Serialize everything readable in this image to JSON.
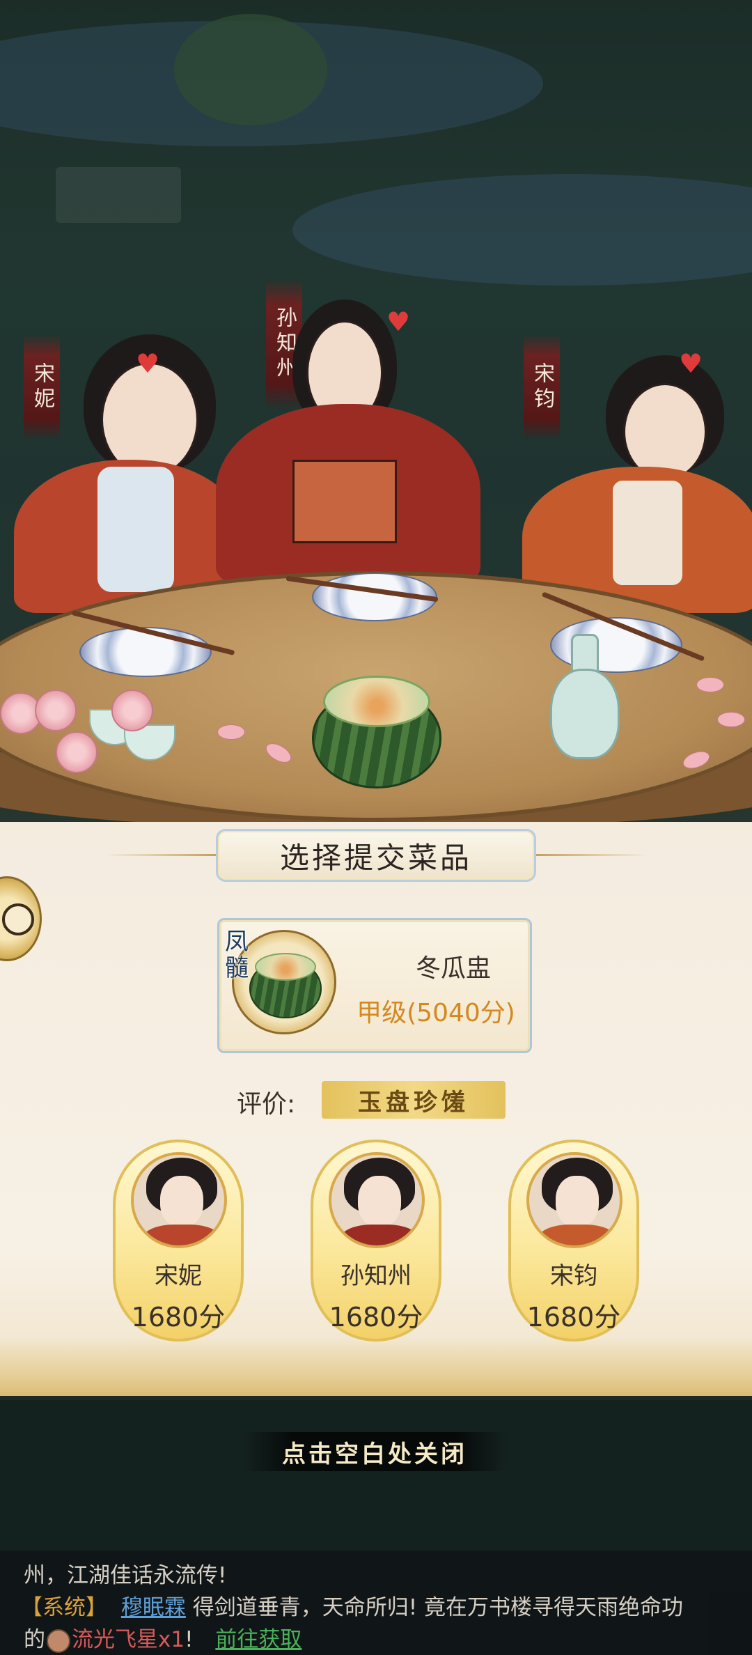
{
  "scene": {
    "characters": [
      {
        "id": "song-ni",
        "name": "宋妮"
      },
      {
        "id": "sun-zhizhou",
        "name": "孙知州"
      },
      {
        "id": "song-jun",
        "name": "宋钧"
      }
    ]
  },
  "panel": {
    "title": "选择提交菜品",
    "dish": {
      "tag": "凤髓",
      "name": "冬瓜盅",
      "grade": "甲级(5040分)"
    },
    "evaluation": {
      "label": "评价:",
      "value": "玉盘珍馐"
    },
    "judges": [
      {
        "name": "宋妮",
        "score": "1680分"
      },
      {
        "name": "孙知州",
        "score": "1680分"
      },
      {
        "name": "宋钧",
        "score": "1680分"
      }
    ]
  },
  "close_hint": "点击空白处关闭",
  "chat": {
    "line1": "州，江湖佳话永流传!",
    "line2": {
      "system_tag": "【系统】",
      "player": "穆眠霖",
      "text": "得剑道垂青，天命所归! 竟在万书楼寻得天雨绝命功"
    },
    "line3": {
      "prefix": "的",
      "item": "流光飞星x1",
      "suffix": "!",
      "link": "前往获取"
    }
  },
  "colors": {
    "grade": "#d3891f",
    "system_tag": "#d9a23c",
    "player_link": "#5f9ed6",
    "item": "#d85a5a",
    "goto_link": "#49b25a",
    "eval_badge": "#e3c15c"
  },
  "icons": {
    "side_button": "chat-bubble-icon",
    "chat_item": "item-icon"
  }
}
